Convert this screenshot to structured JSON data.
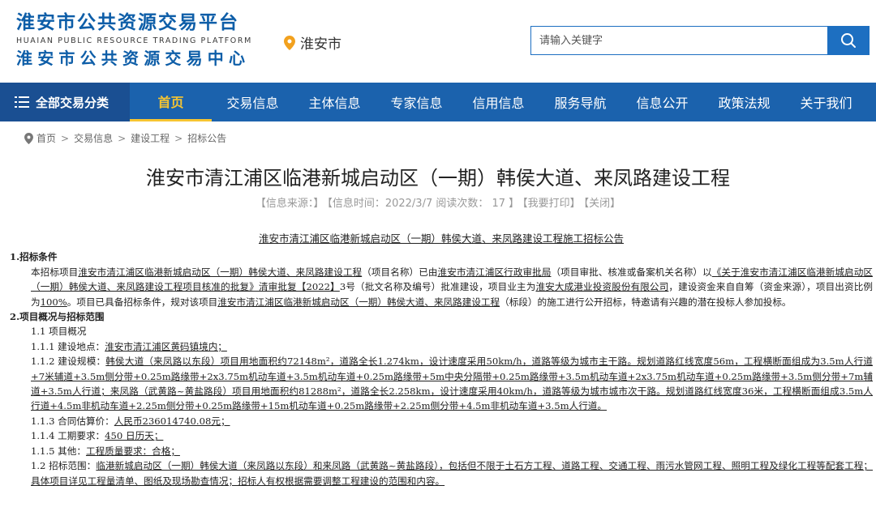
{
  "header": {
    "logo_line1": "淮安市公共资源交易平台",
    "logo_en": "HUAIAN PUBLIC RESOURCE TRADING PLATFORM",
    "logo_line2": "淮安市公共资源交易中心",
    "location": "淮安市",
    "search_placeholder": "请输入关键字"
  },
  "nav": {
    "all_label": "全部交易分类",
    "items": [
      "首页",
      "交易信息",
      "主体信息",
      "专家信息",
      "信用信息",
      "服务导航",
      "信息公开",
      "政策法规",
      "关于我们"
    ],
    "active_index": 0
  },
  "breadcrumb": [
    "首页",
    "交易信息",
    "建设工程",
    "招标公告"
  ],
  "article": {
    "title": "淮安市清江浦区临港新城启动区（一期）韩侯大道、来凤路建设工程",
    "meta": {
      "source": "【信息来源：】",
      "time": "【信息时间：2022/3/7 阅读次数： 17 】",
      "print": "【我要打印】",
      "close": "【关闭】"
    },
    "doc_title": "淮安市清江浦区临港新城启动区（一期）韩侯大道、来凤路建设工程施工招标公告",
    "s1_heading": "1.招标条件",
    "s1_p": {
      "a": "本招标项目",
      "b": "淮安市清江浦区临港新城启动区（一期）韩侯大道、来凤路建设工程",
      "c": "（项目名称）已由",
      "d": "淮安市清江浦区行政审批局",
      "e": "（项目审批、核准或备案机关名称）以",
      "f": "《关于淮安市清江浦区临港新城启动区（一期）韩侯大道、来凤路建设工程项目核准的批复》清审批复【2022】",
      "g": "3号（批文名称及编号）批准建设，项目业主为",
      "h": "淮安大成港业投资股份有限公司",
      "i": "，建设资金来自自筹（资金来源），项目出资比例为",
      "j": "100%",
      "k": "。项目已具备招标条件，规对该项目",
      "l": "淮安市清江浦区临港新城启动区（一期）韩侯大道、来凤路建设工程",
      "m": "（标段）的施工进行公开招标，特邀请有兴趣的潜在投标人参加投标。"
    },
    "s2_heading": "2.项目概况与招标范围",
    "s2_11": "1.1 项目概况",
    "s2_111_label": "1.1.1 建设地点：",
    "s2_111_val": "淮安市清江浦区黄码镇境内；",
    "s2_112_label": "1.1.2 建设规模：",
    "s2_112_val": "韩侯大道（来凤路以东段）项目用地面积约72148m²，道路全长1.274km，设计速度采用50km/h，道路等级为城市主干路。规划道路红线宽度56m，工程横断面组成为3.5m人行道+7米辅道+3.5m侧分带+0.25m路缘带+2x3.75m机动车道+3.5m机动车道+0.25m路缘带+5m中央分隔带+0.25m路缘带+3.5m机动车道+2x3.75m机动车道+0.25m路缘带+3.5m侧分带+7m辅道+3.5m人行道；来凤路（武黄路~黄盐路段）项目用地面积约81288m²，道路全长2.258km，设计速度采用40km/h，道路等级为城市城市次干路。规划道路红线宽度36米，工程横断面组成3.5m人行道+4.5m非机动车道+2.25m侧分带+0.25m路缘带+15m机动车道+0.25m路缘带+2.25m侧分带+4.5m非机动车道+3.5m人行道。",
    "s2_113_label": "1.1.3 合同估算价：",
    "s2_113_val": "人民币236014740.08元；",
    "s2_114_label": "1.1.4 工期要求：",
    "s2_114_val": "450 日历天；",
    "s2_115_label": "1.1.5 其他：",
    "s2_115_val": "工程质量要求：合格；",
    "s2_12_label": "1.2 招标范围：",
    "s2_12_val": "临港新城启动区（一期）韩侯大道（来凤路以东段）和来凤路（武黄路~黄盐路段），包括但不限于土石方工程、道路工程、交通工程、雨污水管网工程、照明工程及绿化工程等配套工程；具体项目详见工程量清单、图纸及现场勘查情况；招标人有权根据需要调整工程建设的范围和内容。"
  }
}
